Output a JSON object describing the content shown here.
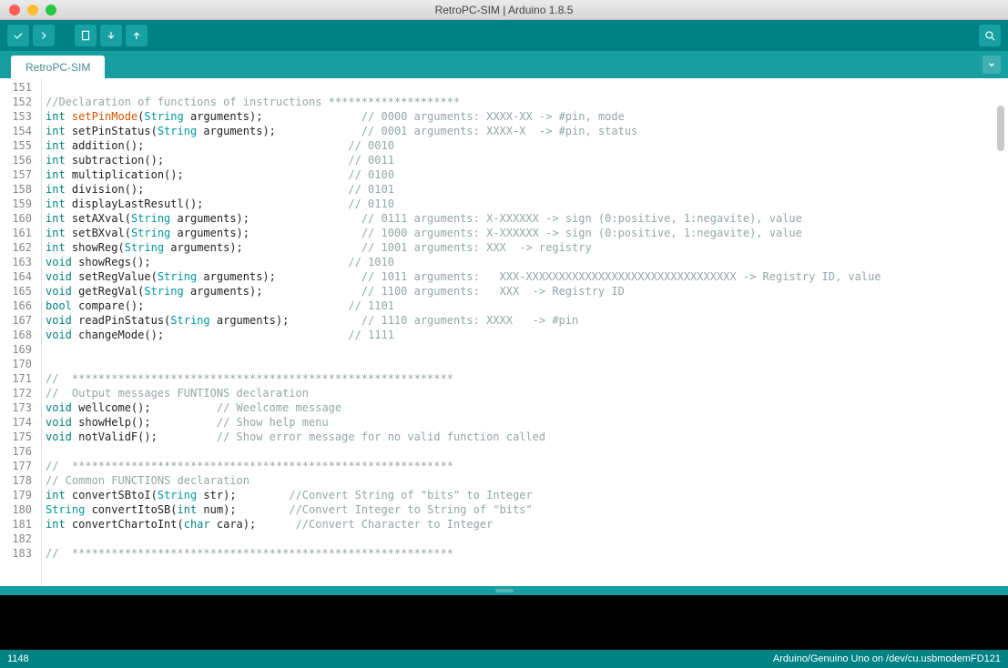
{
  "window": {
    "title": "RetroPC-SIM | Arduino 1.8.5"
  },
  "tabs": [
    {
      "label": "RetroPC-SIM"
    }
  ],
  "toolbar_icons": [
    "verify",
    "upload",
    "new",
    "open",
    "save",
    "serial-monitor"
  ],
  "editor": {
    "first_line_no": 151,
    "lines": [
      {
        "tokens": []
      },
      {
        "tokens": [
          {
            "t": "cmt",
            "s": "//Declaration of functions of instructions ********************"
          }
        ]
      },
      {
        "tokens": [
          {
            "t": "k-type",
            "s": "int"
          },
          {
            "t": "p",
            "s": " "
          },
          {
            "t": "k-func",
            "s": "setPinMode"
          },
          {
            "t": "p",
            "s": "("
          },
          {
            "t": "k-str",
            "s": "String"
          },
          {
            "t": "p",
            "s": " arguments);               "
          },
          {
            "t": "cmt",
            "s": "// 0000 arguments: XXXX-XX -> #pin, mode"
          }
        ]
      },
      {
        "tokens": [
          {
            "t": "k-type",
            "s": "int"
          },
          {
            "t": "p",
            "s": " setPinStatus("
          },
          {
            "t": "k-str",
            "s": "String"
          },
          {
            "t": "p",
            "s": " arguments);             "
          },
          {
            "t": "cmt",
            "s": "// 0001 arguments: XXXX-X  -> #pin, status"
          }
        ]
      },
      {
        "tokens": [
          {
            "t": "k-type",
            "s": "int"
          },
          {
            "t": "p",
            "s": " addition();                               "
          },
          {
            "t": "cmt",
            "s": "// 0010"
          }
        ]
      },
      {
        "tokens": [
          {
            "t": "k-type",
            "s": "int"
          },
          {
            "t": "p",
            "s": " subtraction();                            "
          },
          {
            "t": "cmt",
            "s": "// 0011"
          }
        ]
      },
      {
        "tokens": [
          {
            "t": "k-type",
            "s": "int"
          },
          {
            "t": "p",
            "s": " multiplication();                         "
          },
          {
            "t": "cmt",
            "s": "// 0100"
          }
        ]
      },
      {
        "tokens": [
          {
            "t": "k-type",
            "s": "int"
          },
          {
            "t": "p",
            "s": " division();                               "
          },
          {
            "t": "cmt",
            "s": "// 0101"
          }
        ]
      },
      {
        "tokens": [
          {
            "t": "k-type",
            "s": "int"
          },
          {
            "t": "p",
            "s": " displayLastResutl();                      "
          },
          {
            "t": "cmt",
            "s": "// 0110"
          }
        ]
      },
      {
        "tokens": [
          {
            "t": "k-type",
            "s": "int"
          },
          {
            "t": "p",
            "s": " setAXval("
          },
          {
            "t": "k-str",
            "s": "String"
          },
          {
            "t": "p",
            "s": " arguments);                 "
          },
          {
            "t": "cmt",
            "s": "// 0111 arguments: X-XXXXXX -> sign (0:positive, 1:negavite), value"
          }
        ]
      },
      {
        "tokens": [
          {
            "t": "k-type",
            "s": "int"
          },
          {
            "t": "p",
            "s": " setBXval("
          },
          {
            "t": "k-str",
            "s": "String"
          },
          {
            "t": "p",
            "s": " arguments);                 "
          },
          {
            "t": "cmt",
            "s": "// 1000 arguments: X-XXXXXX -> sign (0:positive, 1:negavite), value"
          }
        ]
      },
      {
        "tokens": [
          {
            "t": "k-type",
            "s": "int"
          },
          {
            "t": "p",
            "s": " showReg("
          },
          {
            "t": "k-str",
            "s": "String"
          },
          {
            "t": "p",
            "s": " arguments);                  "
          },
          {
            "t": "cmt",
            "s": "// 1001 arguments: XXX  -> registry"
          }
        ]
      },
      {
        "tokens": [
          {
            "t": "k-type",
            "s": "void"
          },
          {
            "t": "p",
            "s": " showRegs();                              "
          },
          {
            "t": "cmt",
            "s": "// 1010"
          }
        ]
      },
      {
        "tokens": [
          {
            "t": "k-type",
            "s": "void"
          },
          {
            "t": "p",
            "s": " setRegValue("
          },
          {
            "t": "k-str",
            "s": "String"
          },
          {
            "t": "p",
            "s": " arguments);             "
          },
          {
            "t": "cmt",
            "s": "// 1011 arguments:   XXX-XXXXXXXXXXXXXXXXXXXXXXXXXXXXXXXX -> Registry ID, value"
          }
        ]
      },
      {
        "tokens": [
          {
            "t": "k-type",
            "s": "void"
          },
          {
            "t": "p",
            "s": " getRegVal("
          },
          {
            "t": "k-str",
            "s": "String"
          },
          {
            "t": "p",
            "s": " arguments);               "
          },
          {
            "t": "cmt",
            "s": "// 1100 arguments:   XXX  -> Registry ID"
          }
        ]
      },
      {
        "tokens": [
          {
            "t": "k-type",
            "s": "bool"
          },
          {
            "t": "p",
            "s": " compare();                               "
          },
          {
            "t": "cmt",
            "s": "// 1101"
          }
        ]
      },
      {
        "tokens": [
          {
            "t": "k-type",
            "s": "void"
          },
          {
            "t": "p",
            "s": " readPinStatus("
          },
          {
            "t": "k-str",
            "s": "String"
          },
          {
            "t": "p",
            "s": " arguments);           "
          },
          {
            "t": "cmt",
            "s": "// 1110 arguments: XXXX   -> #pin"
          }
        ]
      },
      {
        "tokens": [
          {
            "t": "k-type",
            "s": "void"
          },
          {
            "t": "p",
            "s": " changeMode();                            "
          },
          {
            "t": "cmt",
            "s": "// 1111"
          }
        ]
      },
      {
        "tokens": []
      },
      {
        "tokens": []
      },
      {
        "tokens": [
          {
            "t": "cmt",
            "s": "//  **********************************************************"
          }
        ]
      },
      {
        "tokens": [
          {
            "t": "cmt",
            "s": "//  Output messages FUNTIONS declaration"
          }
        ]
      },
      {
        "tokens": [
          {
            "t": "k-type",
            "s": "void"
          },
          {
            "t": "p",
            "s": " wellcome();          "
          },
          {
            "t": "cmt",
            "s": "// Weelcome message"
          }
        ]
      },
      {
        "tokens": [
          {
            "t": "k-type",
            "s": "void"
          },
          {
            "t": "p",
            "s": " showHelp();          "
          },
          {
            "t": "cmt",
            "s": "// Show help menu"
          }
        ]
      },
      {
        "tokens": [
          {
            "t": "k-type",
            "s": "void"
          },
          {
            "t": "p",
            "s": " notValidF();         "
          },
          {
            "t": "cmt",
            "s": "// Show error message for no valid function called"
          }
        ]
      },
      {
        "tokens": []
      },
      {
        "tokens": [
          {
            "t": "cmt",
            "s": "//  **********************************************************"
          }
        ]
      },
      {
        "tokens": [
          {
            "t": "cmt",
            "s": "// Common FUNCTIONS declaration"
          }
        ]
      },
      {
        "tokens": [
          {
            "t": "k-type",
            "s": "int"
          },
          {
            "t": "p",
            "s": " convertSBtoI("
          },
          {
            "t": "k-str",
            "s": "String"
          },
          {
            "t": "p",
            "s": " str);        "
          },
          {
            "t": "cmt",
            "s": "//Convert String of \"bits\" to Integer"
          }
        ]
      },
      {
        "tokens": [
          {
            "t": "k-str",
            "s": "String"
          },
          {
            "t": "p",
            "s": " convertItoSB("
          },
          {
            "t": "k-type",
            "s": "int"
          },
          {
            "t": "p",
            "s": " num);        "
          },
          {
            "t": "cmt",
            "s": "//Convert Integer to String of \"bits\""
          }
        ]
      },
      {
        "tokens": [
          {
            "t": "k-type",
            "s": "int"
          },
          {
            "t": "p",
            "s": " convertChartoInt("
          },
          {
            "t": "k-type",
            "s": "char"
          },
          {
            "t": "p",
            "s": " cara);      "
          },
          {
            "t": "cmt",
            "s": "//Convert Character to Integer"
          }
        ]
      },
      {
        "tokens": []
      },
      {
        "tokens": [
          {
            "t": "cmt",
            "s": "//  **********************************************************"
          }
        ]
      }
    ]
  },
  "status": {
    "left": "1148",
    "right": "Arduino/Genuino Uno on /dev/cu.usbmodemFD121"
  }
}
